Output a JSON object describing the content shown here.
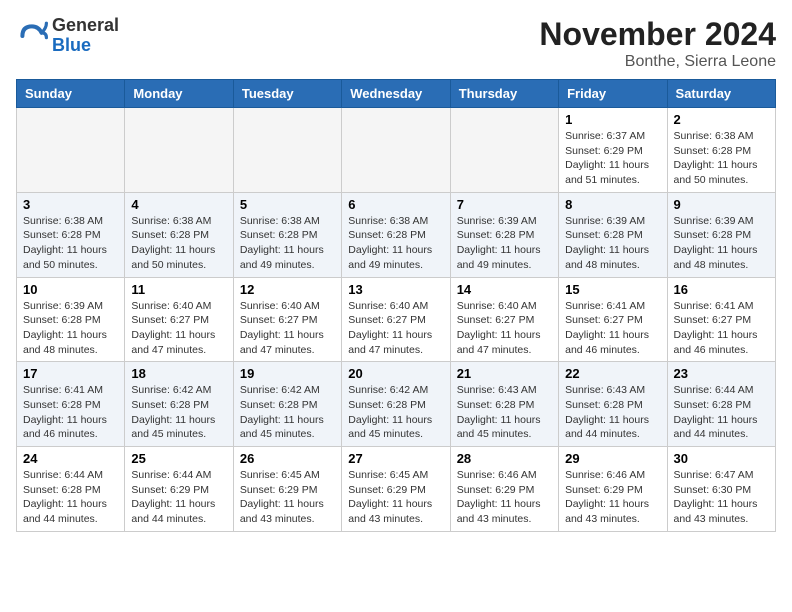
{
  "header": {
    "logo_line1": "General",
    "logo_line2": "Blue",
    "month_title": "November 2024",
    "location": "Bonthe, Sierra Leone"
  },
  "columns": [
    "Sunday",
    "Monday",
    "Tuesday",
    "Wednesday",
    "Thursday",
    "Friday",
    "Saturday"
  ],
  "weeks": [
    [
      {
        "day": "",
        "info": ""
      },
      {
        "day": "",
        "info": ""
      },
      {
        "day": "",
        "info": ""
      },
      {
        "day": "",
        "info": ""
      },
      {
        "day": "",
        "info": ""
      },
      {
        "day": "1",
        "info": "Sunrise: 6:37 AM\nSunset: 6:29 PM\nDaylight: 11 hours and 51 minutes."
      },
      {
        "day": "2",
        "info": "Sunrise: 6:38 AM\nSunset: 6:28 PM\nDaylight: 11 hours and 50 minutes."
      }
    ],
    [
      {
        "day": "3",
        "info": "Sunrise: 6:38 AM\nSunset: 6:28 PM\nDaylight: 11 hours and 50 minutes."
      },
      {
        "day": "4",
        "info": "Sunrise: 6:38 AM\nSunset: 6:28 PM\nDaylight: 11 hours and 50 minutes."
      },
      {
        "day": "5",
        "info": "Sunrise: 6:38 AM\nSunset: 6:28 PM\nDaylight: 11 hours and 49 minutes."
      },
      {
        "day": "6",
        "info": "Sunrise: 6:38 AM\nSunset: 6:28 PM\nDaylight: 11 hours and 49 minutes."
      },
      {
        "day": "7",
        "info": "Sunrise: 6:39 AM\nSunset: 6:28 PM\nDaylight: 11 hours and 49 minutes."
      },
      {
        "day": "8",
        "info": "Sunrise: 6:39 AM\nSunset: 6:28 PM\nDaylight: 11 hours and 48 minutes."
      },
      {
        "day": "9",
        "info": "Sunrise: 6:39 AM\nSunset: 6:28 PM\nDaylight: 11 hours and 48 minutes."
      }
    ],
    [
      {
        "day": "10",
        "info": "Sunrise: 6:39 AM\nSunset: 6:28 PM\nDaylight: 11 hours and 48 minutes."
      },
      {
        "day": "11",
        "info": "Sunrise: 6:40 AM\nSunset: 6:27 PM\nDaylight: 11 hours and 47 minutes."
      },
      {
        "day": "12",
        "info": "Sunrise: 6:40 AM\nSunset: 6:27 PM\nDaylight: 11 hours and 47 minutes."
      },
      {
        "day": "13",
        "info": "Sunrise: 6:40 AM\nSunset: 6:27 PM\nDaylight: 11 hours and 47 minutes."
      },
      {
        "day": "14",
        "info": "Sunrise: 6:40 AM\nSunset: 6:27 PM\nDaylight: 11 hours and 47 minutes."
      },
      {
        "day": "15",
        "info": "Sunrise: 6:41 AM\nSunset: 6:27 PM\nDaylight: 11 hours and 46 minutes."
      },
      {
        "day": "16",
        "info": "Sunrise: 6:41 AM\nSunset: 6:27 PM\nDaylight: 11 hours and 46 minutes."
      }
    ],
    [
      {
        "day": "17",
        "info": "Sunrise: 6:41 AM\nSunset: 6:28 PM\nDaylight: 11 hours and 46 minutes."
      },
      {
        "day": "18",
        "info": "Sunrise: 6:42 AM\nSunset: 6:28 PM\nDaylight: 11 hours and 45 minutes."
      },
      {
        "day": "19",
        "info": "Sunrise: 6:42 AM\nSunset: 6:28 PM\nDaylight: 11 hours and 45 minutes."
      },
      {
        "day": "20",
        "info": "Sunrise: 6:42 AM\nSunset: 6:28 PM\nDaylight: 11 hours and 45 minutes."
      },
      {
        "day": "21",
        "info": "Sunrise: 6:43 AM\nSunset: 6:28 PM\nDaylight: 11 hours and 45 minutes."
      },
      {
        "day": "22",
        "info": "Sunrise: 6:43 AM\nSunset: 6:28 PM\nDaylight: 11 hours and 44 minutes."
      },
      {
        "day": "23",
        "info": "Sunrise: 6:44 AM\nSunset: 6:28 PM\nDaylight: 11 hours and 44 minutes."
      }
    ],
    [
      {
        "day": "24",
        "info": "Sunrise: 6:44 AM\nSunset: 6:28 PM\nDaylight: 11 hours and 44 minutes."
      },
      {
        "day": "25",
        "info": "Sunrise: 6:44 AM\nSunset: 6:29 PM\nDaylight: 11 hours and 44 minutes."
      },
      {
        "day": "26",
        "info": "Sunrise: 6:45 AM\nSunset: 6:29 PM\nDaylight: 11 hours and 43 minutes."
      },
      {
        "day": "27",
        "info": "Sunrise: 6:45 AM\nSunset: 6:29 PM\nDaylight: 11 hours and 43 minutes."
      },
      {
        "day": "28",
        "info": "Sunrise: 6:46 AM\nSunset: 6:29 PM\nDaylight: 11 hours and 43 minutes."
      },
      {
        "day": "29",
        "info": "Sunrise: 6:46 AM\nSunset: 6:29 PM\nDaylight: 11 hours and 43 minutes."
      },
      {
        "day": "30",
        "info": "Sunrise: 6:47 AM\nSunset: 6:30 PM\nDaylight: 11 hours and 43 minutes."
      }
    ]
  ]
}
